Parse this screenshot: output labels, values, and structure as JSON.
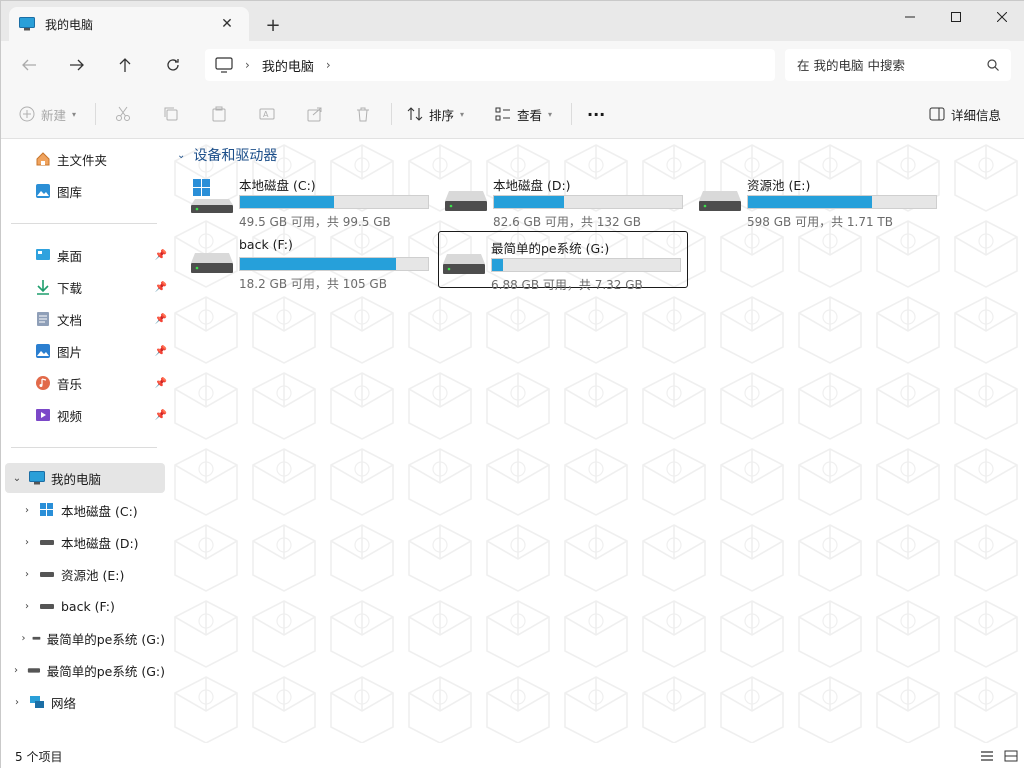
{
  "window": {
    "tab_title": "我的电脑",
    "new_tab": "+",
    "close_tab": "✕"
  },
  "address": {
    "crumb": "我的电脑",
    "search_placeholder": "在 我的电脑 中搜索"
  },
  "toolbar": {
    "new_label": "新建",
    "sort_label": "排序",
    "view_label": "查看",
    "more_label": "···",
    "details_label": "详细信息"
  },
  "sidebar": {
    "quick": [
      {
        "label": "主文件夹",
        "icon": "home-icon"
      },
      {
        "label": "图库",
        "icon": "gallery-icon"
      }
    ],
    "pinned": [
      {
        "label": "桌面",
        "icon": "desktop-icon"
      },
      {
        "label": "下载",
        "icon": "download-icon"
      },
      {
        "label": "文档",
        "icon": "documents-icon"
      },
      {
        "label": "图片",
        "icon": "pictures-icon"
      },
      {
        "label": "音乐",
        "icon": "music-icon"
      },
      {
        "label": "视频",
        "icon": "videos-icon"
      }
    ],
    "tree": {
      "root": "我的电脑",
      "children": [
        "本地磁盘 (C:)",
        "本地磁盘 (D:)",
        "资源池 (E:)",
        "back (F:)",
        "最简单的pe系统 (G:)"
      ],
      "removable": "最简单的pe系统 (G:)",
      "network": "网络"
    }
  },
  "main": {
    "section_title": "设备和驱动器",
    "drives": [
      {
        "name": "本地磁盘 (C:)",
        "info": "49.5 GB 可用，共 99.5 GB",
        "used_fraction": 0.5,
        "windows": true
      },
      {
        "name": "本地磁盘 (D:)",
        "info": "82.6 GB 可用，共 132 GB",
        "used_fraction": 0.37,
        "windows": false
      },
      {
        "name": "资源池 (E:)",
        "info": "598 GB 可用，共 1.71 TB",
        "used_fraction": 0.66,
        "windows": false
      },
      {
        "name": "back (F:)",
        "info": "18.2 GB 可用，共 105 GB",
        "used_fraction": 0.83,
        "windows": false
      },
      {
        "name": "最简单的pe系统 (G:)",
        "info": "6.88 GB 可用，共 7.32 GB",
        "used_fraction": 0.06,
        "windows": false
      }
    ]
  },
  "status": {
    "count": "5 个项目"
  },
  "colors": {
    "accent": "#26a0da",
    "header_blue": "#1d4f8a",
    "selected_bg": "#e5e5e5"
  }
}
